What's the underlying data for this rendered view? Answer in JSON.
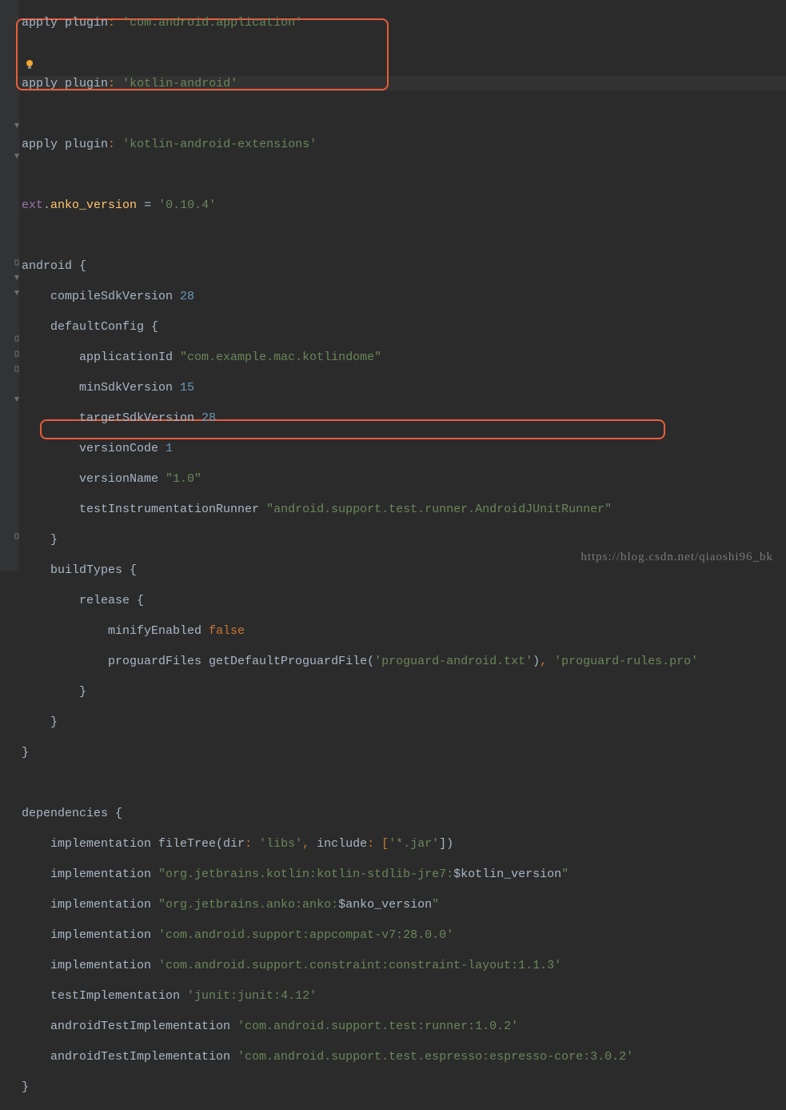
{
  "watermark": "https://blog.csdn.net/qiaoshi96_bk",
  "code": {
    "l0": {
      "a": "apply",
      "p": "plugin",
      "c": ":",
      "v": "'com.android.application'"
    },
    "l2": {
      "a": "apply",
      "p": "plugin",
      "c": ":",
      "v": "'kotlin-android'"
    },
    "l4": {
      "a": "apply",
      "p": "plugin",
      "c": ":",
      "v": "'kotlin-android-extensions'"
    },
    "l6": {
      "e": "ext",
      "dot": ".",
      "n": "anko_version",
      "eq": " = ",
      "v": "'0.10.4'"
    },
    "l8": {
      "a": "android {"
    },
    "l9a": "    compileSdkVersion ",
    "l9n": "28",
    "l10": "    defaultConfig {",
    "l11a": "        applicationId ",
    "l11s": "\"com.example.mac.kotlindome\"",
    "l12a": "        minSdkVersion ",
    "l12n": "15",
    "l13a": "        targetSdkVersion ",
    "l13n": "28",
    "l14a": "        versionCode ",
    "l14n": "1",
    "l15a": "        versionName ",
    "l15s": "\"1.0\"",
    "l16a": "        testInstrumentationRunner ",
    "l16s": "\"android.support.test.runner.AndroidJUnitRunner\"",
    "l17": "    }",
    "l18": "    buildTypes {",
    "l19": "        release {",
    "l20a": "            minifyEnabled ",
    "l20k": "false",
    "l21a": "            proguardFiles getDefaultProguardFile(",
    "l21s": "'proguard-android.txt'",
    "l21b": ")",
    "l21c": ", ",
    "l21s2": "'proguard-rules.pro'",
    "l22": "        }",
    "l23": "    }",
    "l24": "}",
    "l26": "dependencies {",
    "l27a": "    implementation fileTree(",
    "l27d": "dir",
    "l27c": ": ",
    "l27s": "'libs'",
    "l27e": ", ",
    "l27i": "include",
    "l27f": ": [",
    "l27s2": "'*.jar'",
    "l27g": "])",
    "l28a": "    implementation ",
    "l28s1": "\"org.jetbrains.kotlin:kotlin-stdlib-jre7:",
    "l28v": "$kotlin_version",
    "l28s2": "\"",
    "l29a": "    implementation ",
    "l29s1": "\"org.jetbrains.anko:anko:",
    "l29v": "$anko_version",
    "l29s2": "\"",
    "l30a": "    implementation ",
    "l30s": "'com.android.support:appcompat-v7:28.0.0'",
    "l31a": "    implementation ",
    "l31s": "'com.android.support.constraint:constraint-layout:1.1.3'",
    "l32a": "    testImplementation ",
    "l32s": "'junit:junit:4.12'",
    "l33a": "    androidTestImplementation ",
    "l33s": "'com.android.support.test:runner:1.0.2'",
    "l34a": "    androidTestImplementation ",
    "l34s": "'com.android.support.test.espresso:espresso-core:3.0.2'",
    "l35": "}"
  }
}
